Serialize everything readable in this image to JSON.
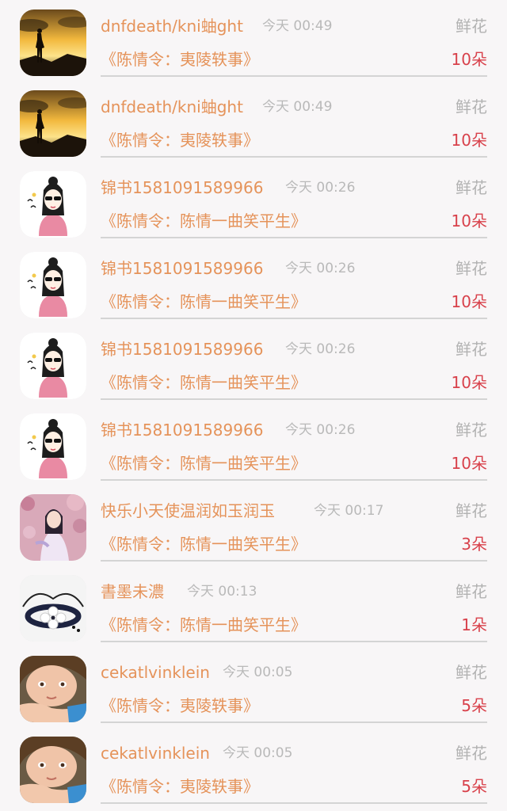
{
  "gift_records": [
    {
      "username": "dnfdeath/kni蚰ght",
      "time": "今天 00:49",
      "gift_type": "鲜花",
      "book": "《陈情令：夷陵轶事》",
      "count": "10朵",
      "avatar": "sunset-silhouette"
    },
    {
      "username": "dnfdeath/kni蚰ght",
      "time": "今天 00:49",
      "gift_type": "鲜花",
      "book": "《陈情令：夷陵轶事》",
      "count": "10朵",
      "avatar": "sunset-silhouette"
    },
    {
      "username": "锦书1581091589966",
      "time": "今天 00:26",
      "gift_type": "鲜花",
      "book": "《陈情令：陈情一曲笑平生》",
      "count": "10朵",
      "avatar": "cartoon-girl-sunglasses"
    },
    {
      "username": "锦书1581091589966",
      "time": "今天 00:26",
      "gift_type": "鲜花",
      "book": "《陈情令：陈情一曲笑平生》",
      "count": "10朵",
      "avatar": "cartoon-girl-sunglasses"
    },
    {
      "username": "锦书1581091589966",
      "time": "今天 00:26",
      "gift_type": "鲜花",
      "book": "《陈情令：陈情一曲笑平生》",
      "count": "10朵",
      "avatar": "cartoon-girl-sunglasses"
    },
    {
      "username": "锦书1581091589966",
      "time": "今天 00:26",
      "gift_type": "鲜花",
      "book": "《陈情令：陈情一曲笑平生》",
      "count": "10朵",
      "avatar": "cartoon-girl-sunglasses"
    },
    {
      "username": "快乐小天使温润如玉润玉",
      "time": "今天 00:17",
      "gift_type": "鲜花",
      "book": "《陈情令：陈情一曲笑平生》",
      "count": "3朵",
      "avatar": "girl-blossoms"
    },
    {
      "username": "書墨未濃",
      "time": "今天 00:13",
      "gift_type": "鲜花",
      "book": "《陈情令：陈情一曲笑平生》",
      "count": "1朵",
      "avatar": "flower-bracelet"
    },
    {
      "username": "cekatlvinklein",
      "time": "今天 00:05",
      "gift_type": "鲜花",
      "book": "《陈情令：夷陵轶事》",
      "count": "5朵",
      "avatar": "child-portrait"
    },
    {
      "username": "cekatlvinklein",
      "time": "今天 00:05",
      "gift_type": "鲜花",
      "book": "《陈情令：夷陵轶事》",
      "count": "5朵",
      "avatar": "child-portrait"
    }
  ],
  "colors": {
    "name": "#e5935a",
    "count": "#d8414b",
    "muted": "#b9b9b9"
  }
}
